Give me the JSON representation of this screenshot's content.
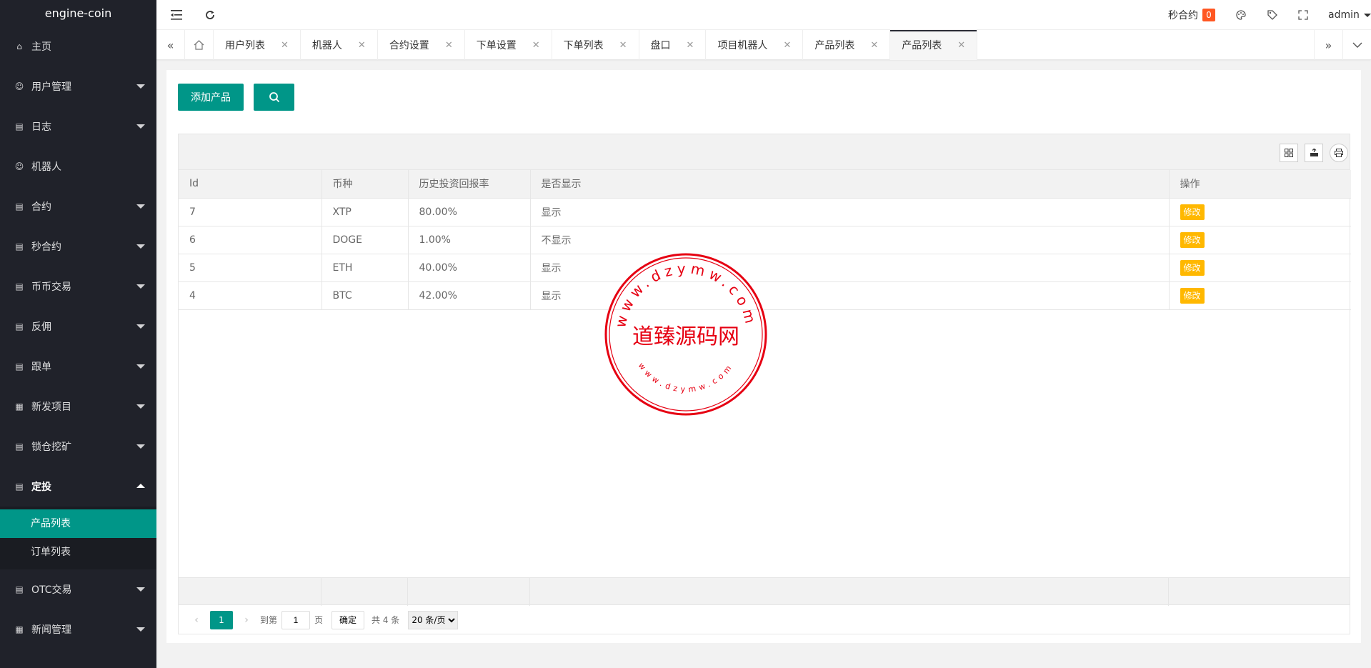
{
  "app": {
    "title": "engine-coin"
  },
  "sidebar": {
    "items": [
      {
        "label": "主页",
        "icon": "home-icon",
        "has_arrow": false
      },
      {
        "label": "用户管理",
        "icon": "user-icon",
        "has_arrow": true
      },
      {
        "label": "日志",
        "icon": "doc-icon",
        "has_arrow": true
      },
      {
        "label": "机器人",
        "icon": "user-icon",
        "has_arrow": false
      },
      {
        "label": "合约",
        "icon": "doc-icon",
        "has_arrow": true
      },
      {
        "label": "秒合约",
        "icon": "doc-icon",
        "has_arrow": true
      },
      {
        "label": "币币交易",
        "icon": "doc-icon",
        "has_arrow": true
      },
      {
        "label": "反佣",
        "icon": "doc-icon",
        "has_arrow": true
      },
      {
        "label": "跟单",
        "icon": "doc-icon",
        "has_arrow": true
      },
      {
        "label": "新发项目",
        "icon": "grid-icon",
        "has_arrow": true
      },
      {
        "label": "锁仓挖矿",
        "icon": "doc-icon",
        "has_arrow": true
      },
      {
        "label": "定投",
        "icon": "doc-icon",
        "has_arrow": true,
        "open": true
      },
      {
        "label": "OTC交易",
        "icon": "doc-icon",
        "has_arrow": true
      },
      {
        "label": "新闻管理",
        "icon": "grid-icon",
        "has_arrow": true
      }
    ],
    "sub_items": [
      {
        "label": "产品列表",
        "active": true
      },
      {
        "label": "订单列表",
        "active": false
      }
    ]
  },
  "header": {
    "second_contract_label": "秒合约",
    "second_contract_badge": "0",
    "user": "admin"
  },
  "tabs": [
    {
      "label": "用户列表"
    },
    {
      "label": "机器人"
    },
    {
      "label": "合约设置"
    },
    {
      "label": "下单设置"
    },
    {
      "label": "下单列表"
    },
    {
      "label": "盘口"
    },
    {
      "label": "项目机器人"
    },
    {
      "label": "产品列表"
    },
    {
      "label": "产品列表",
      "active": true
    }
  ],
  "content": {
    "add_button": "添加产品",
    "columns": [
      "Id",
      "币种",
      "历史投资回报率",
      "是否显示",
      "操作"
    ],
    "rows": [
      {
        "id": "7",
        "coin": "XTP",
        "rate": "80.00%",
        "show": "显示",
        "action": "修改"
      },
      {
        "id": "6",
        "coin": "DOGE",
        "rate": "1.00%",
        "show": "不显示",
        "action": "修改"
      },
      {
        "id": "5",
        "coin": "ETH",
        "rate": "40.00%",
        "show": "显示",
        "action": "修改"
      },
      {
        "id": "4",
        "coin": "BTC",
        "rate": "42.00%",
        "show": "显示",
        "action": "修改"
      }
    ]
  },
  "pager": {
    "current": "1",
    "goto_label": "到第",
    "goto_value": "1",
    "page_label": "页",
    "confirm": "确定",
    "total": "共 4 条",
    "per_page": "20 条/页"
  },
  "watermark": {
    "top_text": "www.dzymw.com",
    "center_text": "道臻源码网",
    "bottom_text": "www.dzymw.com",
    "color": "#e60012"
  }
}
